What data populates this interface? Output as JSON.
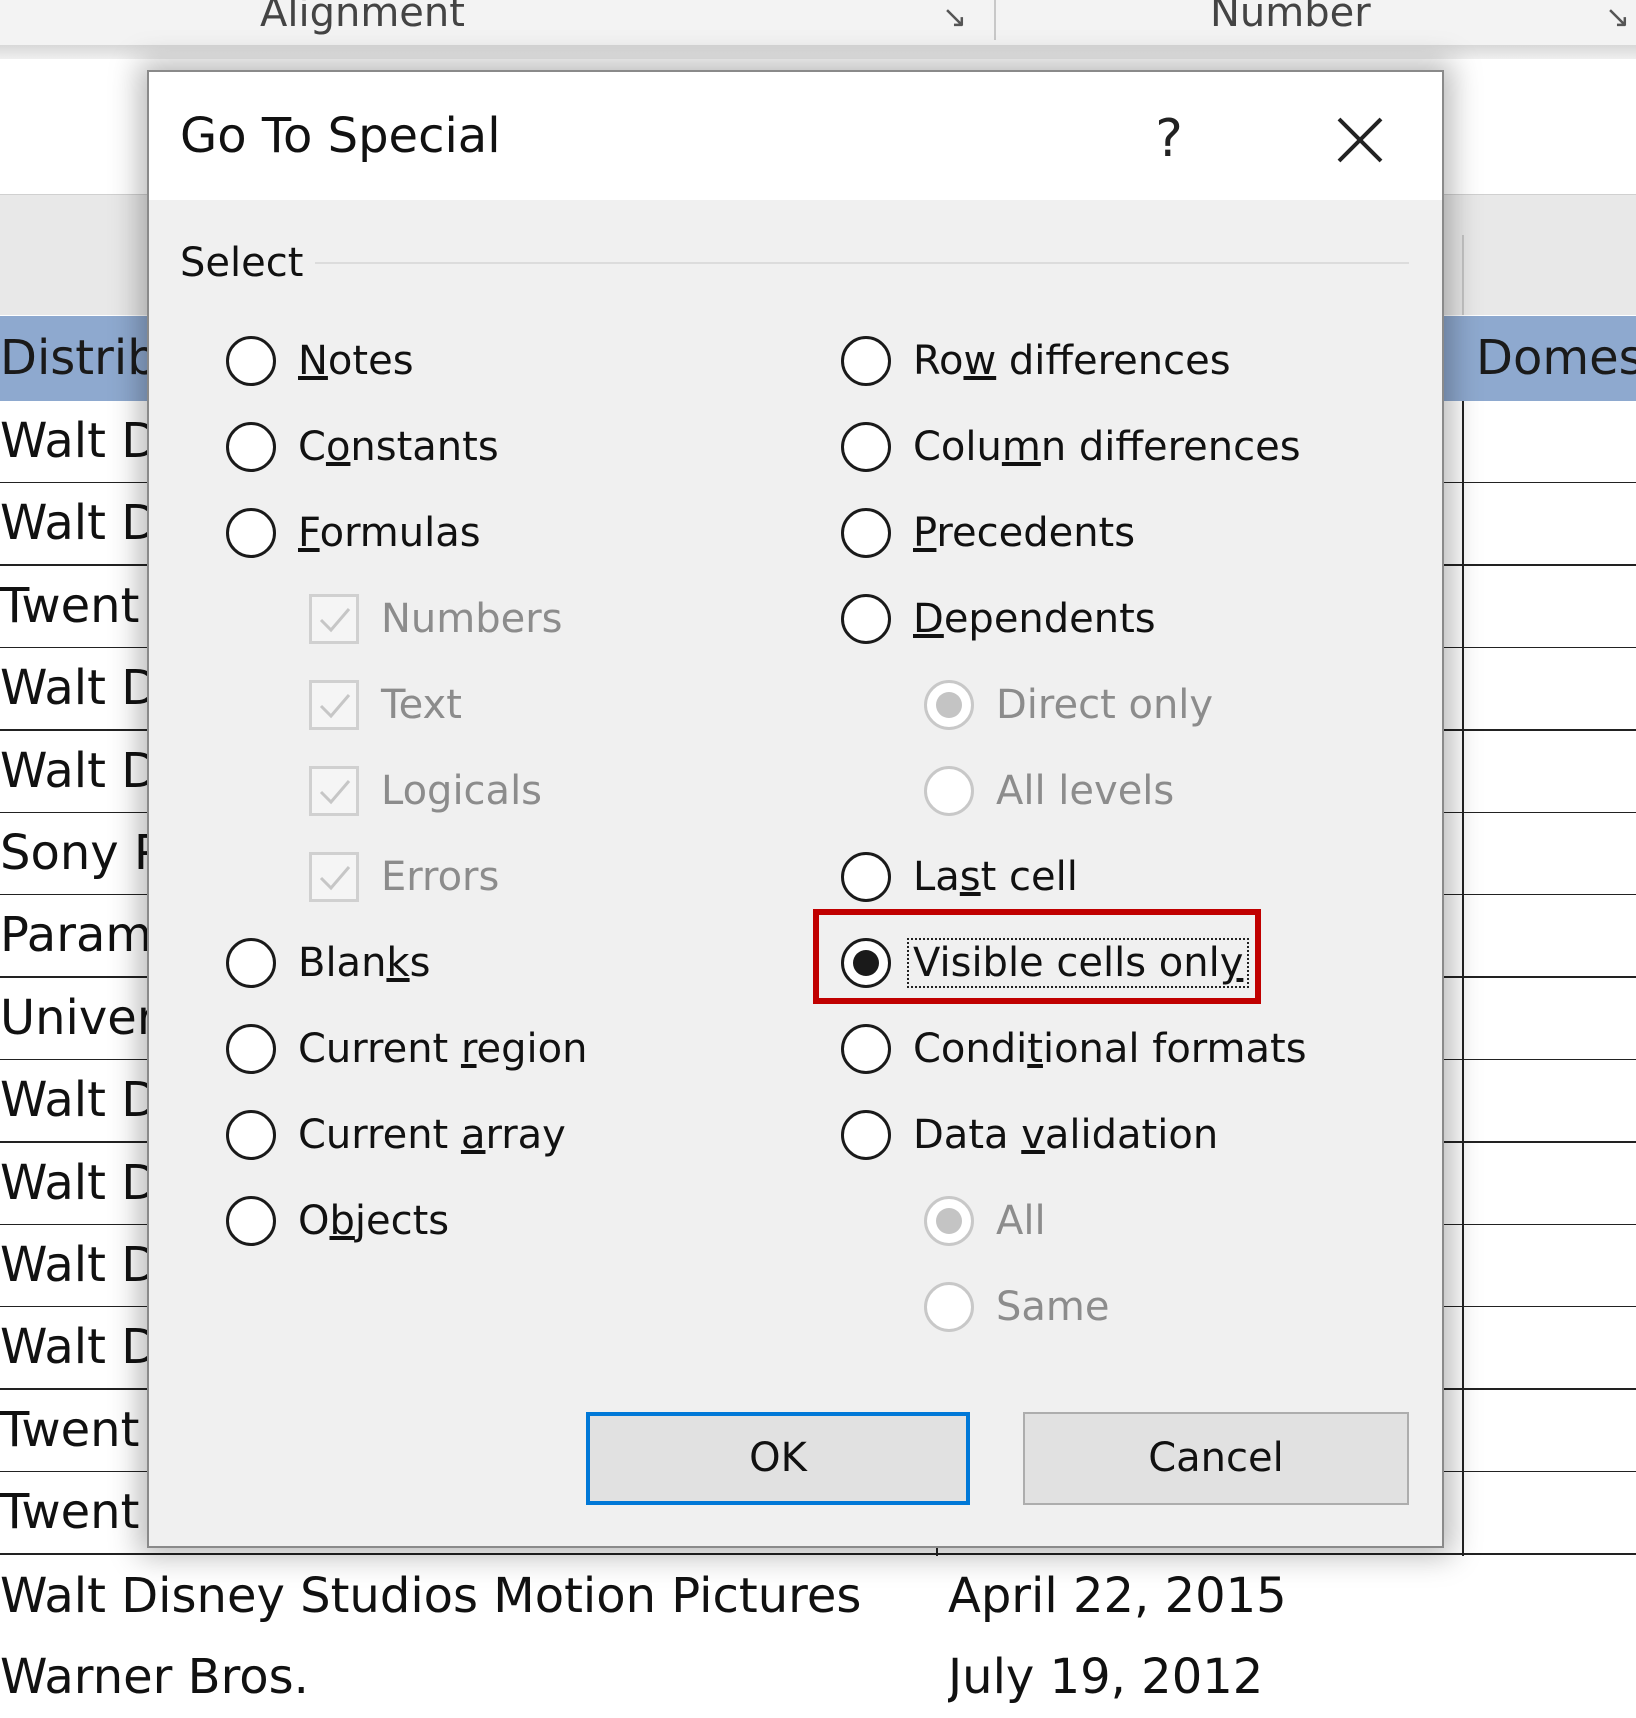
{
  "ribbon": {
    "alignment_label": "Alignment",
    "number_label": "Number",
    "launcher_glyph": "↘"
  },
  "sheet": {
    "header_left": "Distrib",
    "header_right": "Domes",
    "rows_left": [
      "Walt D",
      "Walt D",
      "Twent",
      "Walt D",
      "Walt D",
      "Sony P",
      "Param",
      "Univer",
      "Walt D",
      "Walt D",
      "Walt D",
      "Walt D",
      "Twent",
      "Twent"
    ],
    "bottom_rows": [
      {
        "distributor": "Walt Disney Studios Motion Pictures",
        "date": "April 22, 2015"
      },
      {
        "distributor": "Warner Bros.",
        "date": "July 19, 2012"
      }
    ]
  },
  "dialog": {
    "title": "Go To Special",
    "help_label": "?",
    "group_label": "Select",
    "left_options": [
      {
        "pre": "",
        "key": "N",
        "post": "otes"
      },
      {
        "pre": "C",
        "key": "o",
        "post": "nstants"
      },
      {
        "pre": "",
        "key": "F",
        "post": "ormulas"
      }
    ],
    "formula_checks": [
      "Numbers",
      "Text",
      "Logicals",
      "Errors"
    ],
    "left_options_2": [
      {
        "pre": "Blan",
        "key": "k",
        "post": "s"
      },
      {
        "pre": "Current ",
        "key": "r",
        "post": "egion"
      },
      {
        "pre": "Current ",
        "key": "a",
        "post": "rray"
      },
      {
        "pre": "O",
        "key": "b",
        "post": "jects"
      }
    ],
    "right_options": [
      {
        "pre": "Ro",
        "key": "w",
        "post": " differences"
      },
      {
        "pre": "Colu",
        "key": "m",
        "post": "n differences"
      },
      {
        "pre": "",
        "key": "P",
        "post": "recedents"
      },
      {
        "pre": "",
        "key": "D",
        "post": "ependents"
      }
    ],
    "dependents_sub": [
      "Direct only",
      "All levels"
    ],
    "right_options_2": [
      {
        "pre": "La",
        "key": "s",
        "post": "t cell"
      },
      {
        "pre": "Visible cells onl",
        "key": "y",
        "post": ""
      },
      {
        "pre": "Condi",
        "key": "t",
        "post": "ional formats"
      },
      {
        "pre": "Data ",
        "key": "v",
        "post": "alidation"
      }
    ],
    "validation_sub": [
      "All",
      "Same"
    ],
    "ok_label": "OK",
    "cancel_label": "Cancel",
    "selected_option": "Visible cells only",
    "highlight_color": "#c00000",
    "accent_color": "#0078d7"
  }
}
